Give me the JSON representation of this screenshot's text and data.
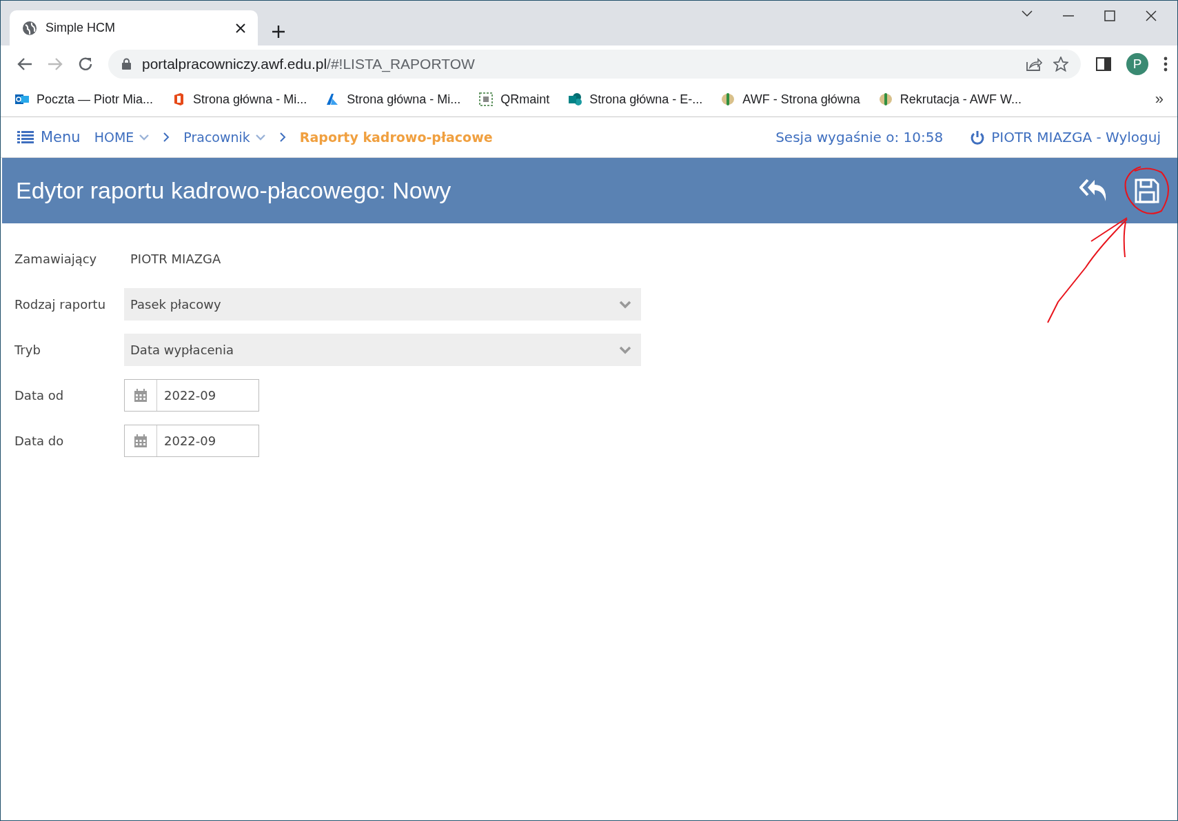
{
  "browser": {
    "tabs": [
      {
        "title": "Simple HCM",
        "selected": true
      }
    ],
    "url": {
      "host": "portalpracowniczy.awf.edu.pl",
      "path": "/#!LISTA_RAPORTOW"
    },
    "profile_initial": "P",
    "bookmarks": [
      {
        "label": "Poczta — Piotr Mia...",
        "kind": "mail"
      },
      {
        "label": "Strona główna - Mi...",
        "kind": "office"
      },
      {
        "label": "Strona główna - Mi...",
        "kind": "azure"
      },
      {
        "label": "QRmaint",
        "kind": "qr"
      },
      {
        "label": "Strona główna - E-...",
        "kind": "sharepoint"
      },
      {
        "label": "AWF - Strona główna",
        "kind": "emblem"
      },
      {
        "label": "Rekrutacja - AWF W...",
        "kind": "emblem"
      }
    ],
    "more_bookmarks": "»"
  },
  "navbar": {
    "menu_label": "Menu",
    "breadcrumbs": [
      {
        "label": "HOME",
        "dropdown": true,
        "selected": false
      },
      {
        "label": "Pracownik",
        "dropdown": true,
        "selected": false
      },
      {
        "label": "Raporty kadrowo-płacowe",
        "dropdown": false,
        "selected": true
      }
    ],
    "session": "Sesja wygaśnie o: 10:58",
    "logout": "PIOTR MIAZGA - Wyloguj"
  },
  "header": {
    "title": "Edytor raportu kadrowo-płacowego: Nowy"
  },
  "form": {
    "fields": [
      {
        "label": "Zamawiający",
        "kind": "text",
        "value": "PIOTR MIAZGA"
      },
      {
        "label": "Rodzaj raportu",
        "kind": "select",
        "value": "Pasek płacowy"
      },
      {
        "label": "Tryb",
        "kind": "select",
        "value": "Data wypłacenia"
      },
      {
        "label": "Data od",
        "kind": "date",
        "value": "2022-09"
      },
      {
        "label": "Data do",
        "kind": "date",
        "value": "2022-09"
      }
    ]
  }
}
